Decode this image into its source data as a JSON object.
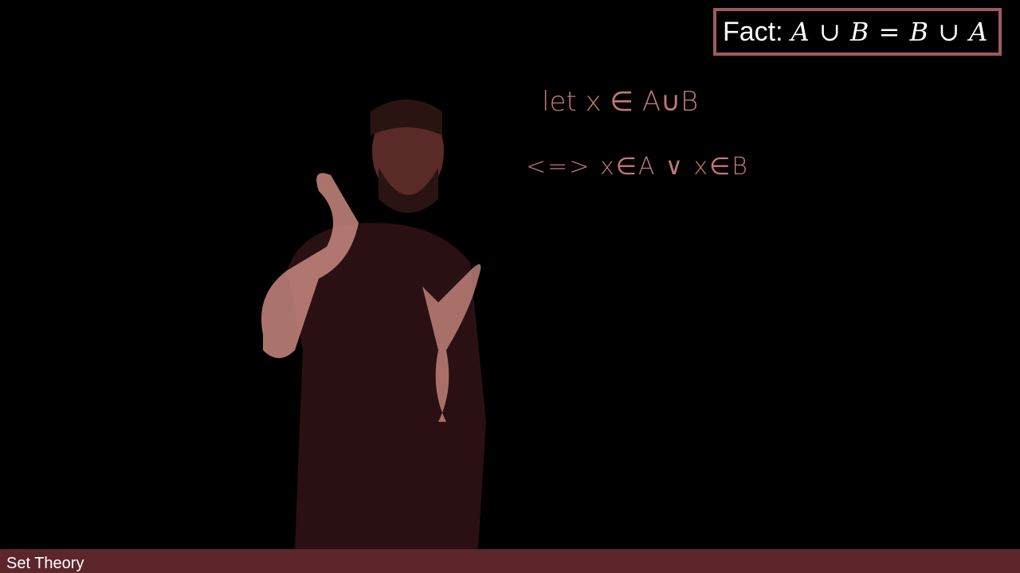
{
  "fact_box": {
    "label": "Fact:",
    "equation": "A ∪ B = B ∪ A"
  },
  "board": {
    "line1": "let x ∈ A∪B",
    "line2": "<=> x∈A ∨ x∈B"
  },
  "bottom_bar": {
    "title": "Set Theory"
  },
  "colors": {
    "accent": "#5c262b",
    "box_border": "#9c5c5e",
    "ink": "#d9877f"
  }
}
